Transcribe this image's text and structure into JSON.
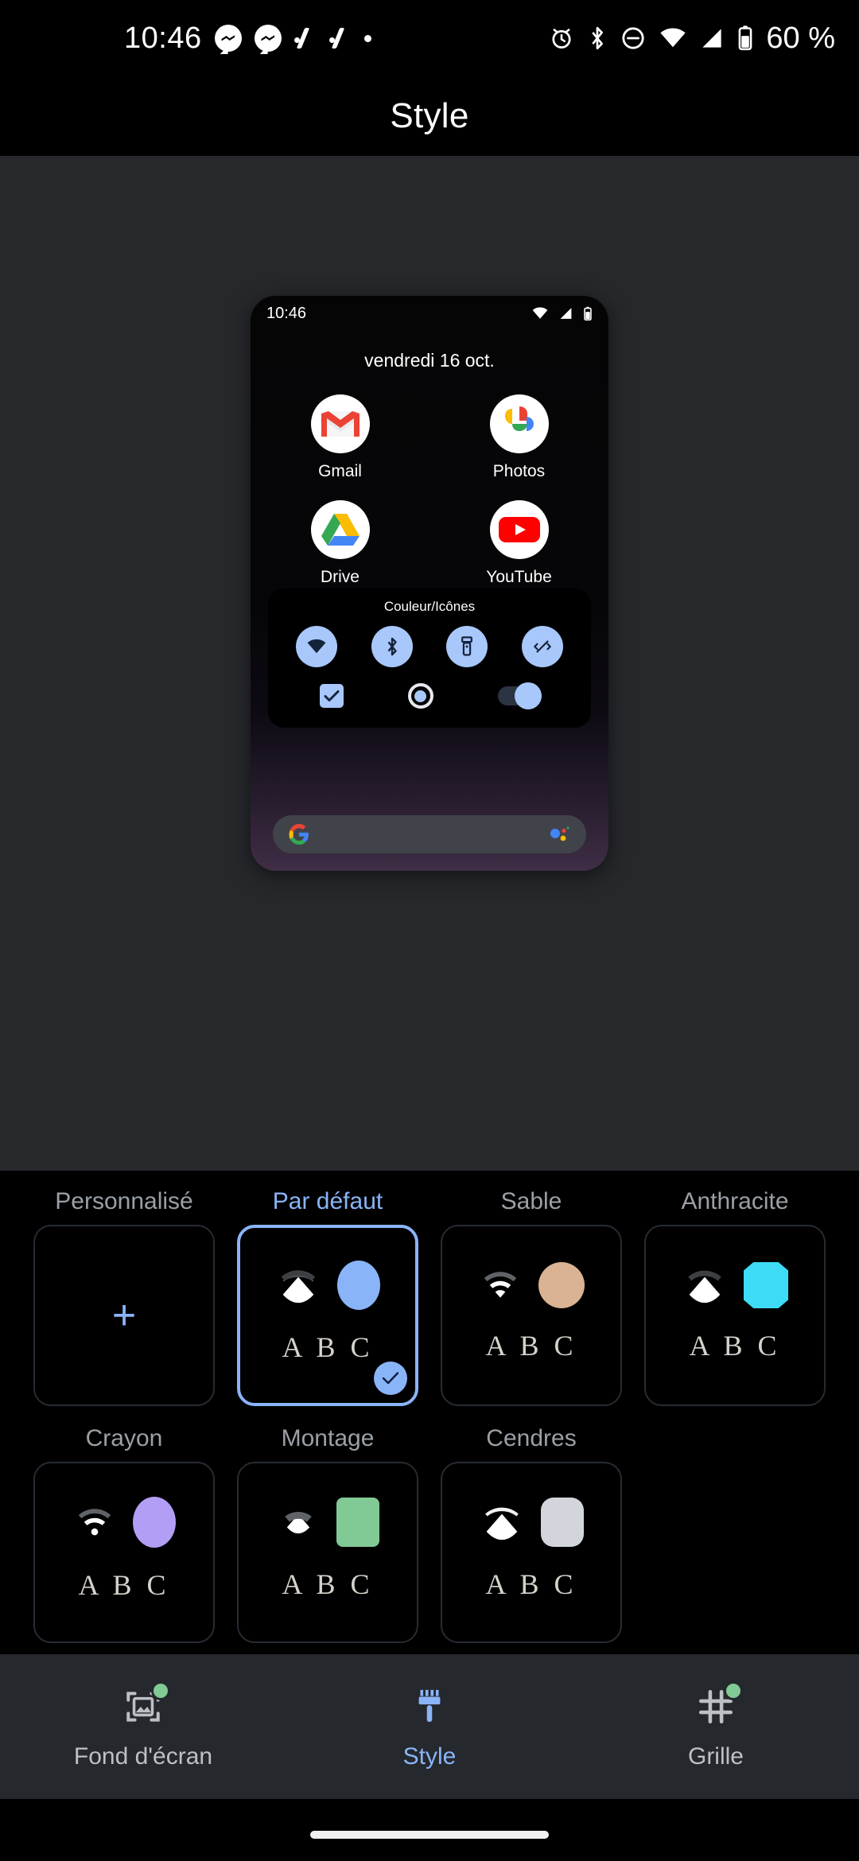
{
  "status_bar": {
    "clock": "10:46",
    "battery_percent": "60 %",
    "left_icons": [
      "messenger-icon",
      "messenger-icon",
      "tick-icon",
      "tick-icon",
      "dot-icon"
    ],
    "right_icons": [
      "alarm-icon",
      "bluetooth-icon",
      "do-not-disturb-icon",
      "wifi-icon",
      "signal-icon",
      "battery-icon"
    ]
  },
  "header": {
    "title": "Style"
  },
  "preview": {
    "clock": "10:46",
    "date": "vendredi 16 oct.",
    "sys_icons": [
      "wifi-icon",
      "signal-icon",
      "battery-icon"
    ],
    "apps": [
      {
        "label": "Gmail",
        "icon": "gmail-icon"
      },
      {
        "label": "Photos",
        "icon": "google-photos-icon"
      },
      {
        "label": "Drive",
        "icon": "google-drive-icon"
      },
      {
        "label": "YouTube",
        "icon": "youtube-icon"
      }
    ],
    "quick_settings": {
      "title": "Couleur/Icônes",
      "tiles": [
        "wifi-icon",
        "bluetooth-icon",
        "flashlight-icon",
        "auto-rotate-icon"
      ],
      "tile_color": "#a8c7fa",
      "controls": [
        "checkbox-checked",
        "radio-selected",
        "switch-on"
      ]
    },
    "search": {
      "logo": "google-g-icon",
      "assistant": "google-assistant-icon",
      "placeholder": ""
    }
  },
  "themes": {
    "rows": [
      [
        {
          "name": "Personnalisé",
          "type": "add",
          "selected": false,
          "add_glyph": "+",
          "accent": "#8ab4f8"
        },
        {
          "name": "Par défaut",
          "type": "theme",
          "selected": true,
          "wifi_style": "filled",
          "swatch_color": "#8ab4f8",
          "swatch_shape": "oval",
          "sample_text": "A B C"
        },
        {
          "name": "Sable",
          "type": "theme",
          "selected": false,
          "wifi_style": "outline",
          "swatch_color": "#d9b393",
          "swatch_shape": "circle",
          "sample_text": "A B C"
        },
        {
          "name": "Anthracite",
          "type": "theme",
          "selected": false,
          "wifi_style": "filled",
          "swatch_color": "#3ddbf5",
          "swatch_shape": "octagon",
          "sample_text": "A B C"
        }
      ],
      [
        {
          "name": "Crayon",
          "type": "theme",
          "selected": false,
          "wifi_style": "outline",
          "swatch_color": "#b39ef5",
          "swatch_shape": "oval",
          "sample_text": "A B C"
        },
        {
          "name": "Montage",
          "type": "theme",
          "selected": false,
          "wifi_style": "half",
          "swatch_color": "#81c995",
          "swatch_shape": "rounded-square",
          "sample_text": "A B C"
        },
        {
          "name": "Cendres",
          "type": "theme",
          "selected": false,
          "wifi_style": "filled",
          "swatch_color": "#d2d6dc",
          "swatch_shape": "rounded-rect",
          "sample_text": "A B C"
        }
      ]
    ],
    "check_badge_color": "#8ab4f8"
  },
  "bottom_nav": {
    "items": [
      {
        "label": "Fond d'écran",
        "icon": "wallpaper-icon",
        "active": false,
        "badge": true
      },
      {
        "label": "Style",
        "icon": "paintbrush-icon",
        "active": true,
        "badge": false
      },
      {
        "label": "Grille",
        "icon": "grid-icon",
        "active": false,
        "badge": true
      }
    ],
    "active_color": "#8ab4f8",
    "badge_color": "#81c995"
  }
}
